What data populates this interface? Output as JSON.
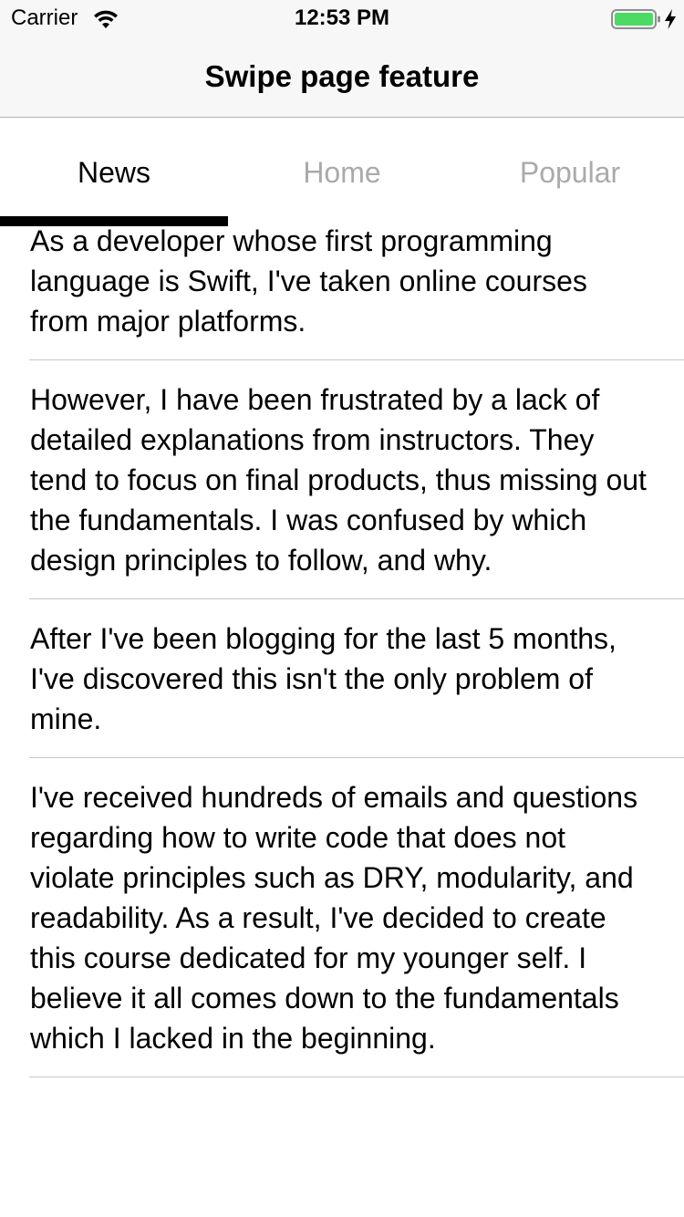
{
  "status_bar": {
    "carrier": "Carrier",
    "time": "12:53 PM",
    "battery_color": "#4cd964",
    "icons": [
      "wifi-icon",
      "battery-icon",
      "charging-bolt-icon"
    ]
  },
  "nav_bar": {
    "title": "Swipe page feature"
  },
  "tabs": [
    {
      "label": "News",
      "active": true
    },
    {
      "label": "Home",
      "active": false
    },
    {
      "label": "Popular",
      "active": false
    }
  ],
  "list": {
    "items": [
      {
        "text": "As a developer whose first programming language is Swift, I've taken online courses from major platforms."
      },
      {
        "text": "However, I have been frustrated by a lack of detailed explanations from instructors. They tend to focus on final products, thus missing out the fundamentals. I was confused by which design principles to follow, and why."
      },
      {
        "text": "After I've been blogging for the last 5 months, I've discovered this isn't the only problem of mine."
      },
      {
        "text": "I've received hundreds of emails and questions regarding how to write code that does not violate principles such as DRY, modularity, and readability. As a result, I've decided to create this course dedicated for my younger self. I believe it all comes down to the fundamentals which I lacked in the beginning."
      }
    ]
  }
}
